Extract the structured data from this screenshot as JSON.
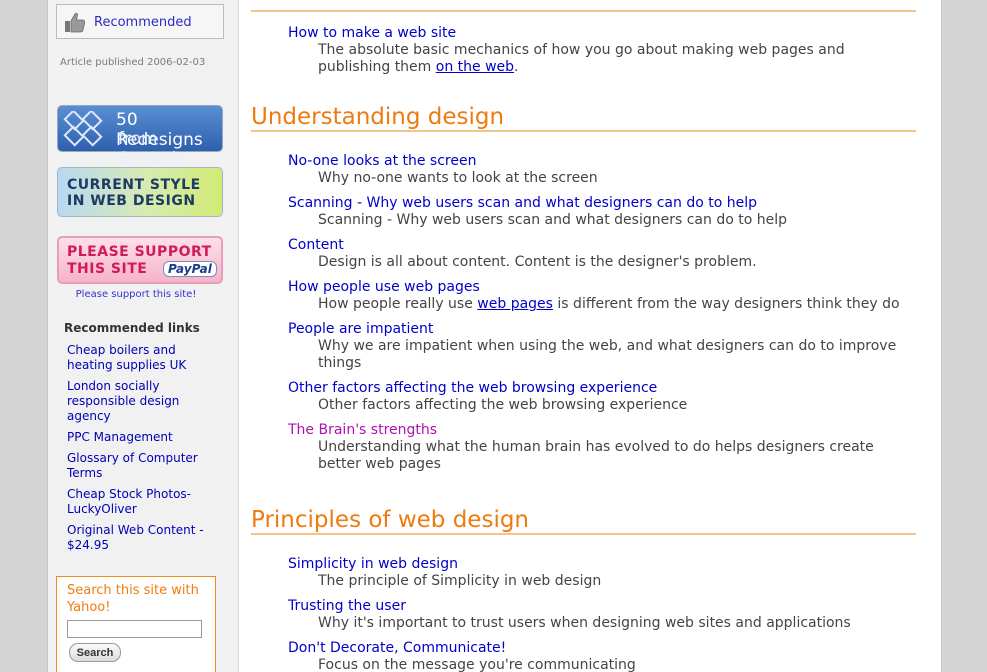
{
  "sidebar": {
    "recommended_label": "Recommended",
    "published": "Article published 2006-02-03",
    "banner_50": {
      "line1": "50 Redesigns",
      "line2": "from Scratch"
    },
    "banner_current": {
      "line1": "CURRENT STYLE",
      "line2": "IN WEB DESIGN"
    },
    "banner_support": {
      "line1": "PLEASE SUPPORT",
      "line2": "THIS SITE",
      "paypal": "PayPal"
    },
    "support_link": "Please support this site!",
    "recommended_links_title": "Recommended links",
    "recommended_links": [
      "Cheap boilers and heating supplies UK",
      "London socially responsible design agency",
      "PPC Management",
      "Glossary of Computer Terms",
      "Cheap Stock Photos- LuckyOliver",
      "Original Web Content - $24.95"
    ],
    "search": {
      "title": "Search this site with Yahoo!",
      "value": "",
      "button": "Search"
    }
  },
  "main": {
    "section0": {
      "entries": [
        {
          "title": "How to make a web site",
          "desc_pre": "The absolute basic mechanics of how you go about making web pages and publishing them ",
          "desc_link": "on the web",
          "desc_post": "."
        }
      ]
    },
    "section1": {
      "heading": "Understanding design",
      "entries": [
        {
          "title": "No-one looks at the screen",
          "desc": "Why no-one wants to look at the screen"
        },
        {
          "title": "Scanning - Why web users scan and what designers can do to help",
          "desc": "Scanning - Why web users scan and what designers can do to help"
        },
        {
          "title": "Content",
          "desc": "Design is all about content. Content is the designer's problem."
        },
        {
          "title": "How people use web pages",
          "desc_pre": "How people really use ",
          "desc_link": "web pages",
          "desc_post": " is different from the way designers think they do"
        },
        {
          "title": "People are impatient",
          "desc": "Why we are impatient when using the web, and what designers can do to improve things"
        },
        {
          "title": "Other factors affecting the web browsing experience",
          "desc": "Other factors affecting the web browsing experience"
        },
        {
          "title": "The Brain's strengths",
          "desc": "Understanding what the human brain has evolved to do helps designers create better web pages"
        }
      ]
    },
    "section2": {
      "heading": "Principles of web design",
      "entries": [
        {
          "title": "Simplicity in web design",
          "desc": "The principle of Simplicity in web design"
        },
        {
          "title": "Trusting the user",
          "desc": "Why it's important to trust users when designing web sites and applications"
        },
        {
          "title": "Don't Decorate, Communicate!",
          "desc": "Focus on the message you're communicating"
        }
      ]
    }
  },
  "colors": {
    "heading": "#ee7b10",
    "link": "#0000c8",
    "visited": "#b010b0",
    "rule": "#f5c48a"
  },
  "icons": {
    "recommend": "thumbs-up-icon"
  }
}
